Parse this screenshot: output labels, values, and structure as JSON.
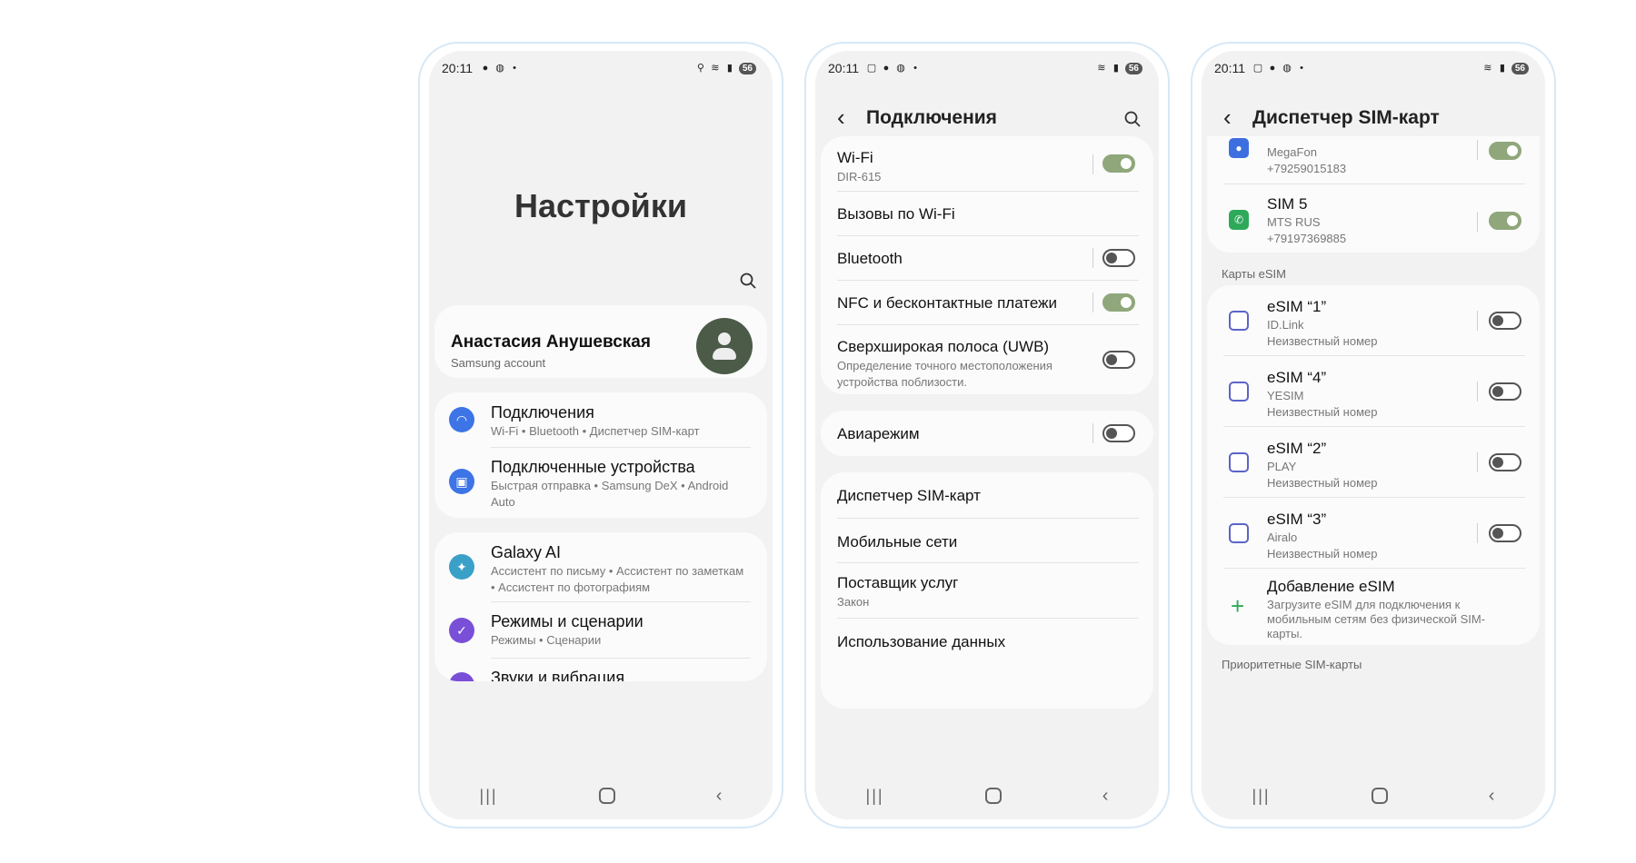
{
  "status": {
    "time": "20:11",
    "battery": "56"
  },
  "phone1": {
    "title": "Настройки",
    "profile": {
      "name": "Анастасия Анушевская",
      "sub": "Samsung account"
    },
    "items": [
      {
        "title": "Подключения",
        "sub": "Wi-Fi  •  Bluetooth  •  Диспетчер SIM-карт",
        "icon": "wifi-icon",
        "color": "#3d74e6"
      },
      {
        "title": "Подключенные устройства",
        "sub": "Быстрая отправка  •  Samsung DeX  •  Android Auto",
        "icon": "devices-icon",
        "color": "#3d74e6"
      },
      {
        "title": "Galaxy AI",
        "sub": "Ассистент по письму  •  Ассистент по заметкам  •  Ассистент по фотографиям",
        "icon": "sparkle-icon",
        "color": "#3aa0c8"
      },
      {
        "title": "Режимы и сценарии",
        "sub": "Режимы  •  Сценарии",
        "icon": "check-circle-icon",
        "color": "#7a4fd8"
      },
      {
        "title": "Звуки и вибрация",
        "sub": "",
        "icon": "sound-icon",
        "color": "#7a4fd8"
      }
    ]
  },
  "phone2": {
    "header": "Подключения",
    "group1": [
      {
        "title": "Wi-Fi",
        "sub": "DIR-615",
        "toggle": true
      },
      {
        "title": "Вызовы по Wi-Fi",
        "sub": ""
      },
      {
        "title": "Bluetooth",
        "sub": "",
        "toggle": false
      },
      {
        "title": "NFC и бесконтактные платежи",
        "sub": "",
        "toggle": true
      },
      {
        "title": "Сверхширокая полоса (UWB)",
        "sub": "Определение точного местоположения устройства поблизости.",
        "toggle": false
      }
    ],
    "group2": [
      {
        "title": "Авиарежим",
        "toggle": false
      }
    ],
    "group3": [
      {
        "title": "Диспетчер SIM-карт",
        "sub": ""
      },
      {
        "title": "Мобильные сети",
        "sub": ""
      },
      {
        "title": "Поставщик услуг",
        "sub": "Закон"
      },
      {
        "title": "Использование данных",
        "sub": ""
      }
    ]
  },
  "phone3": {
    "header": "Диспетчер SIM-карт",
    "sims": [
      {
        "title": "",
        "carrier": "MegaFon",
        "number": "+79259015183",
        "toggle": true
      },
      {
        "title": "SIM 5",
        "carrier": "MTS RUS",
        "number": "+79197369885",
        "toggle": true
      }
    ],
    "esim_label": "Карты eSIM",
    "esims": [
      {
        "title": "eSIM “1”",
        "carrier": "ID.Link",
        "number": "Неизвестный номер",
        "toggle": false
      },
      {
        "title": "eSIM “4”",
        "carrier": "YESIM",
        "number": "Неизвестный номер",
        "toggle": false
      },
      {
        "title": "eSIM “2”",
        "carrier": "PLAY",
        "number": "Неизвестный номер",
        "toggle": false
      },
      {
        "title": "eSIM “3”",
        "carrier": "Airalo",
        "number": "Неизвестный номер",
        "toggle": false
      }
    ],
    "add_esim": {
      "title": "Добавление eSIM",
      "sub": "Загрузите eSIM для подключения к мобильным сетям без физической SIM-карты."
    },
    "priority_label": "Приоритетные SIM-карты"
  }
}
